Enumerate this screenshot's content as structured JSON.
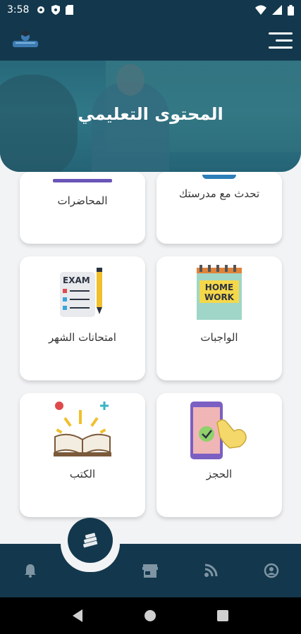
{
  "status": {
    "time": "3:58"
  },
  "header": {
    "title": "المحتوى التعليمي"
  },
  "cards": {
    "lectures": "المحاضرات",
    "chat": "تحدث مع مدرستك",
    "exams": "امتحانات الشهر",
    "homework": "الواجبات",
    "books": "الكتب",
    "booking": "الحجز"
  },
  "illustrations": {
    "exam_word": "EXAM",
    "homework_line1": "HOME",
    "homework_line2": "WORK"
  },
  "colors": {
    "primary": "#13384d",
    "accent": "#2d6f80"
  }
}
